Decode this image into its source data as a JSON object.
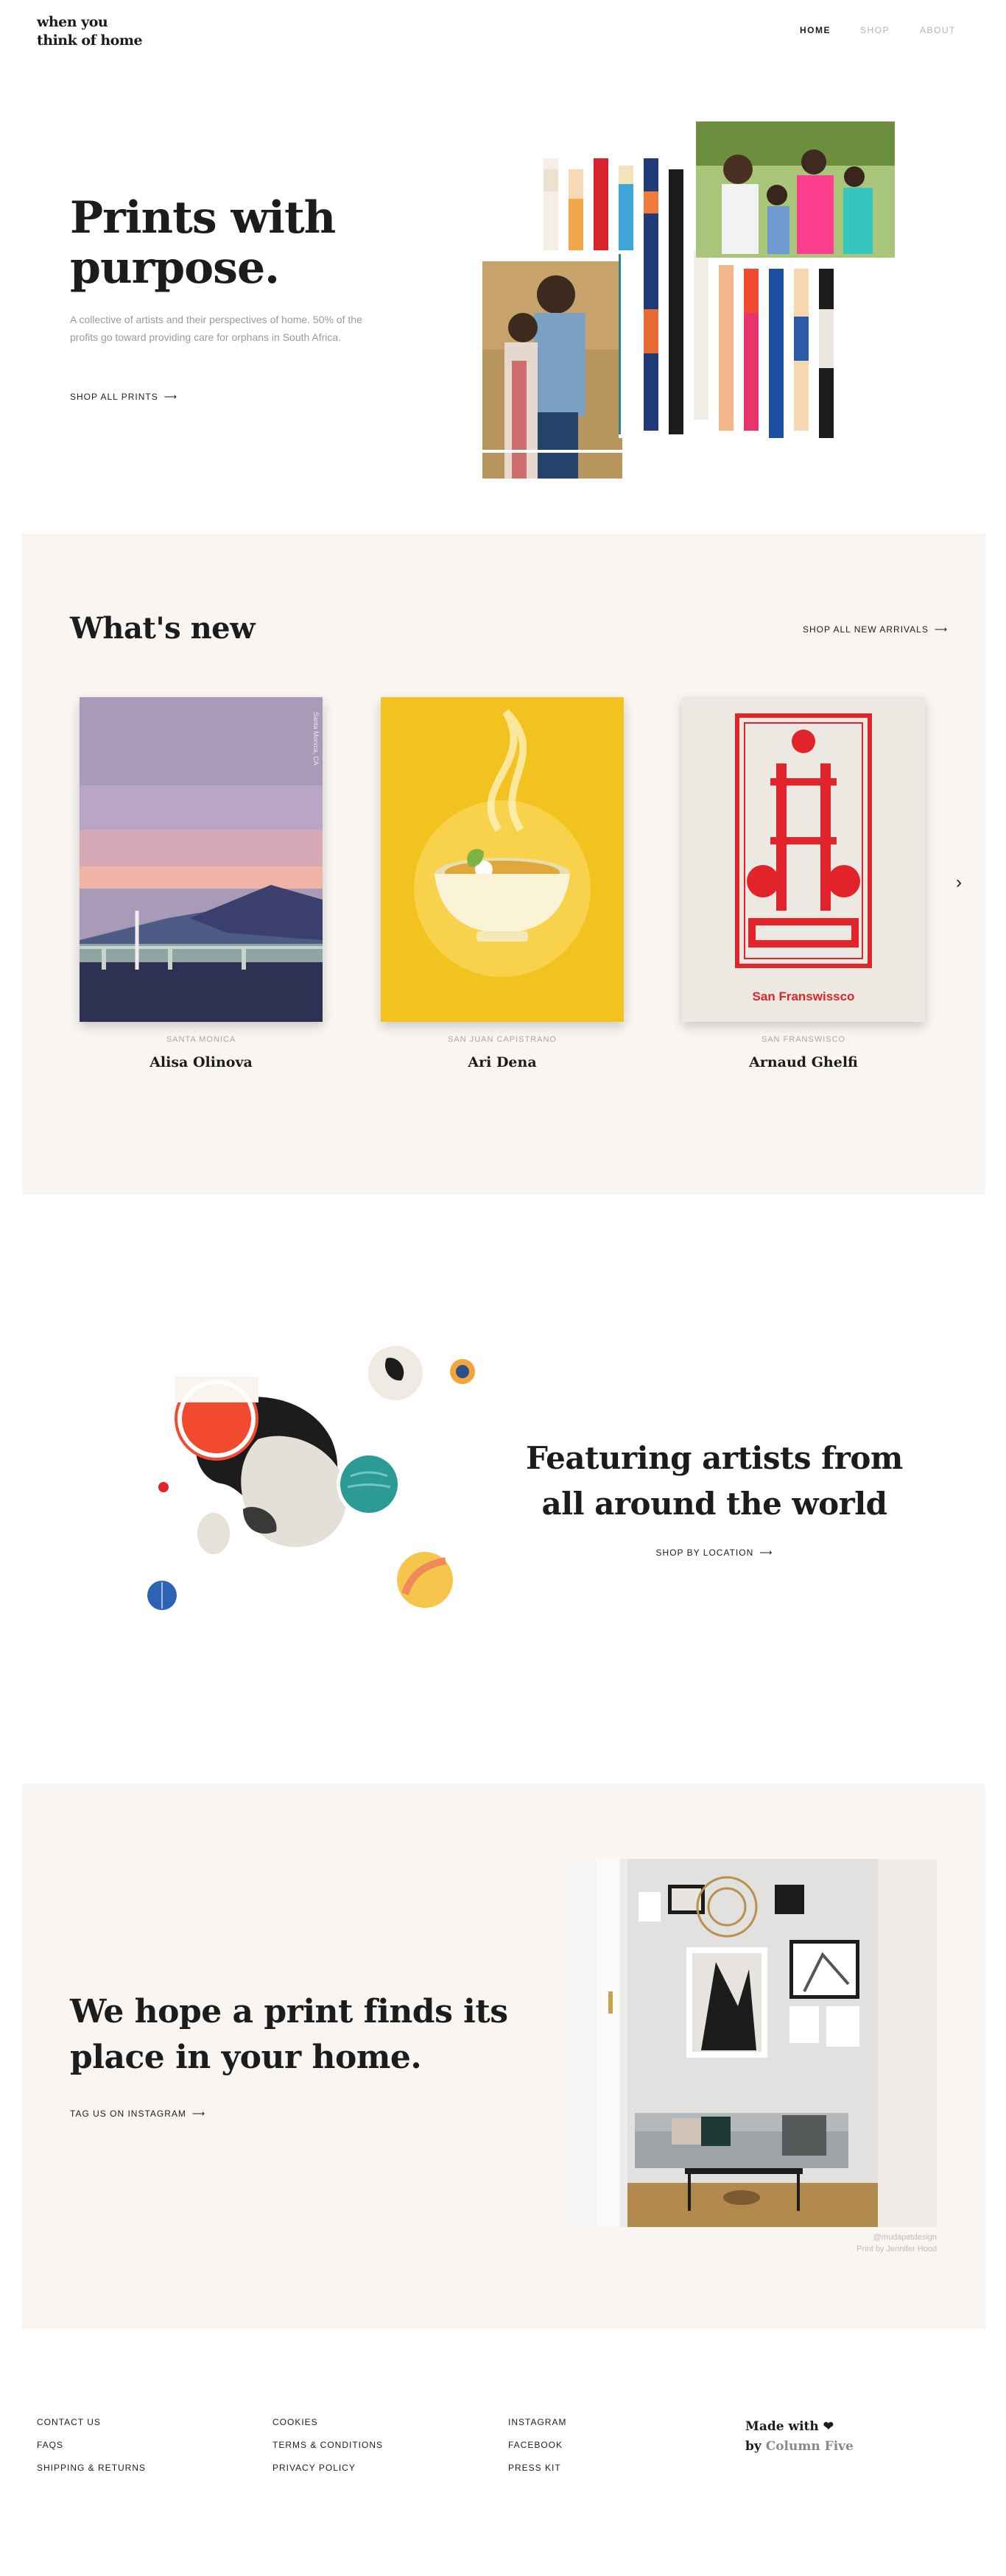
{
  "header": {
    "logo_line1": "when you",
    "logo_line2": "think of home",
    "nav": [
      "HOME",
      "SHOP",
      "ABOUT"
    ]
  },
  "hero": {
    "title_line1": "Prints with",
    "title_line2": "purpose.",
    "description": "A collective of artists and their perspectives of home. 50% of the profits go toward providing care for orphans in South Africa.",
    "cta": "SHOP ALL PRINTS",
    "arrow": "⟶"
  },
  "whats_new": {
    "title": "What's new",
    "cta": "SHOP ALL NEW ARRIVALS",
    "arrow": "⟶",
    "next_icon": "chevron-right-icon",
    "items": [
      {
        "location": "SANTA MONICA",
        "artist": "Alisa Olinova",
        "print_text": "Santa Monica, CA"
      },
      {
        "location": "SAN JUAN CAPISTRANO",
        "artist": "Ari Dena"
      },
      {
        "location": "SAN FRANSWISCO",
        "artist": "Arnaud Ghelfi",
        "print_text": "San Franswissco"
      }
    ]
  },
  "featuring": {
    "title_line1": "Featuring artists from",
    "title_line2": "all around the world",
    "cta": "SHOP BY LOCATION",
    "arrow": "⟶"
  },
  "home": {
    "title_line1": "We hope a print finds its",
    "title_line2": "place in your home.",
    "cta": "TAG US ON INSTAGRAM",
    "arrow": "⟶",
    "credit_handle": "@mudapetdesign",
    "credit_prefix": "Print by",
    "credit_artist": "Jennifer Hood"
  },
  "footer": {
    "col1": [
      "CONTACT US",
      "FAQS",
      "SHIPPING & RETURNS"
    ],
    "col2": [
      "COOKIES",
      "TERMS & CONDITIONS",
      "PRIVACY POLICY"
    ],
    "col3": [
      "INSTAGRAM",
      "FACEBOOK",
      "PRESS KIT"
    ],
    "made_line": "Made with",
    "heart": "❤",
    "by": "by",
    "studio": "Column Five"
  },
  "colors": {
    "beige": "#f8f5f2",
    "text": "#1c1c1c",
    "muted": "#9a9a9a",
    "accent_red": "#e2232a"
  }
}
